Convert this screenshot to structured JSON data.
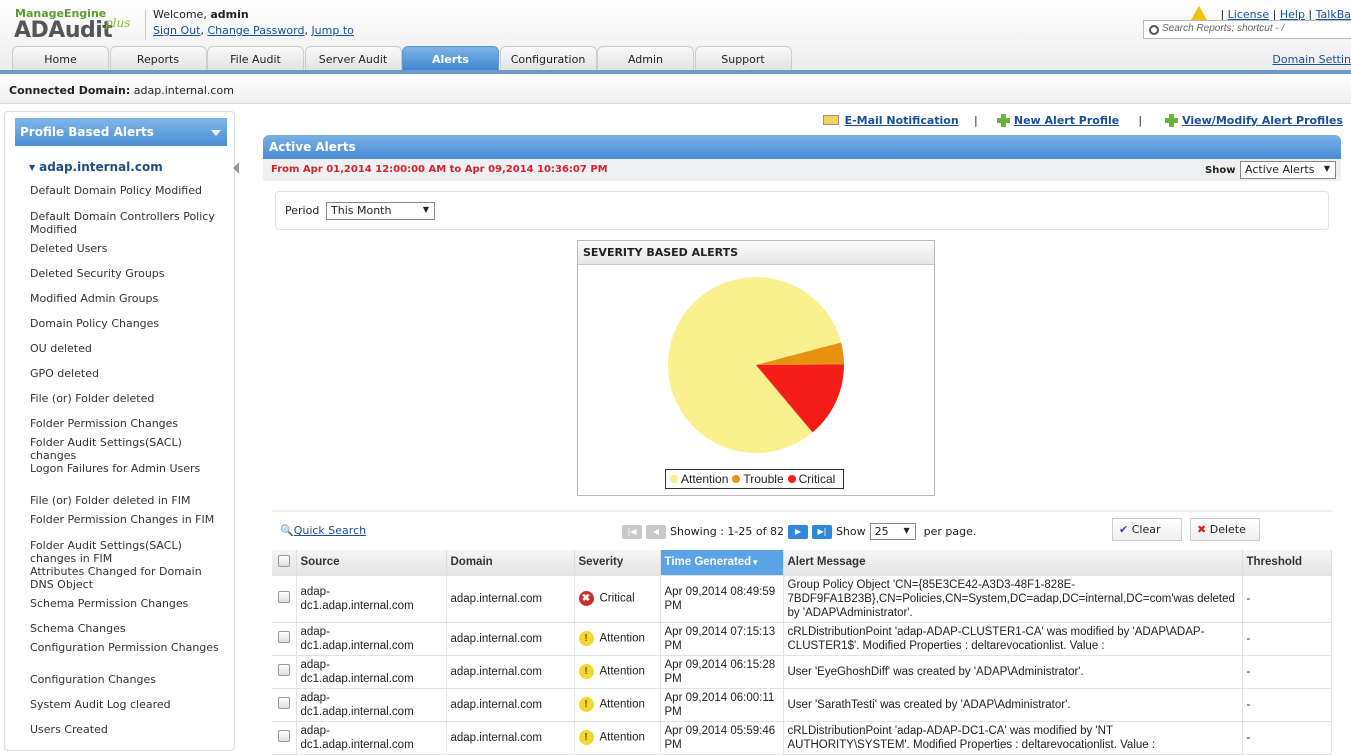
{
  "header": {
    "brand": "ManageEngine",
    "product": "ADAudit",
    "product_suffix": "plus",
    "welcome": "Welcome,",
    "user": "admin",
    "sign_out": "Sign Out",
    "change_password": "Change Password",
    "jump_to": "Jump to",
    "links": [
      "License",
      "Help",
      "TalkBa"
    ],
    "search_placeholder": "Search Reports; shortcut - /",
    "domain_settings": "Domain Settin"
  },
  "tabs": [
    {
      "label": "Home"
    },
    {
      "label": "Reports"
    },
    {
      "label": "File Audit"
    },
    {
      "label": "Server Audit"
    },
    {
      "label": "Alerts",
      "active": true
    },
    {
      "label": "Configuration"
    },
    {
      "label": "Admin"
    },
    {
      "label": "Support"
    }
  ],
  "connected": {
    "label": "Connected Domain:",
    "value": "adap.internal.com"
  },
  "sidebar": {
    "title": "Profile Based Alerts",
    "domain": "adap.internal.com",
    "items": [
      "Default Domain Policy Modified",
      "Default Domain Controllers Policy Modified",
      "Deleted Users",
      "Deleted Security Groups",
      "Modified Admin Groups",
      "Domain Policy Changes",
      "OU deleted",
      "GPO deleted",
      "File (or) Folder deleted",
      "Folder Permission Changes",
      "Folder Audit Settings(SACL) changes",
      "Logon Failures for Admin Users",
      "File (or) Folder deleted in FIM",
      "Folder Permission Changes in FIM",
      "Folder Audit Settings(SACL) changes in FIM",
      "Attributes Changed for Domain DNS Object",
      "Schema Permission Changes",
      "Schema Changes",
      "Configuration Permission Changes",
      "Configuration Changes",
      "System Audit Log cleared",
      "Users Created"
    ]
  },
  "actions": {
    "email": "E-Mail Notification",
    "new_profile": "New Alert Profile",
    "view_profiles": "View/Modify Alert Profiles"
  },
  "panel": {
    "title": "Active Alerts",
    "range": "From Apr 01,2014 12:00:00 AM to Apr 09,2014 10:36:07 PM",
    "show_label": "Show",
    "show_value": "Active Alerts",
    "period_label": "Period",
    "period_value": "This Month"
  },
  "chart_data": {
    "type": "pie",
    "title": "SEVERITY BASED ALERTS",
    "categories": [
      "Attention",
      "Trouble",
      "Critical"
    ],
    "values": [
      82,
      4,
      14
    ],
    "colors": [
      "#fbf08e",
      "#e8920f",
      "#f51d17"
    ],
    "legend": "bottom"
  },
  "grid": {
    "quick_search": "Quick Search",
    "showing": "Showing :  1-25 of 82",
    "show": "Show",
    "per_page_value": "25",
    "per_page": "per page.",
    "clear": "Clear",
    "delete": "Delete",
    "columns": [
      "Source",
      "Domain",
      "Severity",
      "Time Generated",
      "Alert Message",
      "Threshold"
    ],
    "rows": [
      {
        "source": "adap-dc1.adap.internal.com",
        "domain": "adap.internal.com",
        "severity": "Critical",
        "time": "Apr 09,2014 08:49:59 PM",
        "message": "Group Policy Object 'CN={85E3CE42-A3D3-48F1-828E-7BDF9FA1B23B},CN=Policies,CN=System,DC=adap,DC=internal,DC=com'was deleted by 'ADAP\\Administrator'.",
        "threshold": "-"
      },
      {
        "source": "adap-dc1.adap.internal.com",
        "domain": "adap.internal.com",
        "severity": "Attention",
        "time": "Apr 09,2014 07:15:13 PM",
        "message": "cRLDistributionPoint 'adap-ADAP-CLUSTER1-CA' was modified by 'ADAP\\ADAP-CLUSTER1$'. Modified Properties : deltarevocationlist. Value :",
        "threshold": "-"
      },
      {
        "source": "adap-dc1.adap.internal.com",
        "domain": "adap.internal.com",
        "severity": "Attention",
        "time": "Apr 09,2014 06:15:28 PM",
        "message": "User 'EyeGhoshDiff' was created by 'ADAP\\Administrator'.",
        "threshold": "-"
      },
      {
        "source": "adap-dc1.adap.internal.com",
        "domain": "adap.internal.com",
        "severity": "Attention",
        "time": "Apr 09,2014 06:00:11 PM",
        "message": "User 'SarathTesti' was created by 'ADAP\\Administrator'.",
        "threshold": "-"
      },
      {
        "source": "adap-dc1.adap.internal.com",
        "domain": "adap.internal.com",
        "severity": "Attention",
        "time": "Apr 09,2014 05:59:46 PM",
        "message": "cRLDistributionPoint 'adap-ADAP-DC1-CA' was modified by 'NT AUTHORITY\\SYSTEM'. Modified Properties : deltarevocationlist. Value :",
        "threshold": "-"
      }
    ]
  }
}
